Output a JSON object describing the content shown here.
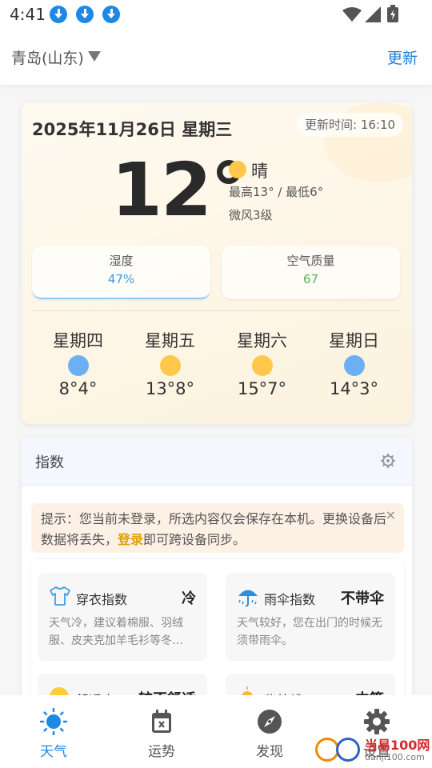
{
  "status_bar": {
    "time": "4:41"
  },
  "header": {
    "city": "青岛(山东)",
    "refresh_label": "更新"
  },
  "weather": {
    "date": "2025年11月26日 星期三",
    "update_time": "更新时间: 16:10",
    "temperature": "12°",
    "condition": "晴",
    "high_low": "最高13° / 最低6°",
    "wind": "微风3级",
    "humidity_label": "湿度",
    "humidity_value": "47%",
    "air_label": "空气质量",
    "air_value": "67",
    "colors": {
      "sun": "#ffc84a",
      "rain": "#6ab0f2",
      "humidity": "#3a9be0",
      "air": "#5bb05b"
    },
    "forecast": [
      {
        "day": "星期四",
        "icon": "rain-icon",
        "temp": "8°4°"
      },
      {
        "day": "星期五",
        "icon": "sun-icon",
        "temp": "13°8°"
      },
      {
        "day": "星期六",
        "icon": "sun-icon",
        "temp": "15°7°"
      },
      {
        "day": "星期日",
        "icon": "rain-icon",
        "temp": "14°3°"
      }
    ]
  },
  "index": {
    "title": "指数",
    "notice_prefix": "提示：您当前未登录，所选内容仅会保存在本机。更换设备后数据将丢失，",
    "notice_login": "登录",
    "notice_suffix": "即可跨设备同步。",
    "close_label": "×",
    "items": [
      {
        "name": "穿衣指数",
        "level": "冷",
        "icon": "shirt-icon",
        "desc": "天气冷，建议着棉服、羽绒服、皮夹克加羊毛衫等冬…"
      },
      {
        "name": "雨伞指数",
        "level": "不带伞",
        "icon": "umbrella-icon",
        "desc": "天气较好，您在出门的时候无须带雨伞。"
      },
      {
        "name": "舒适度",
        "level": "较不舒适",
        "icon": "face-icon",
        "desc": ""
      },
      {
        "name": "紫外线",
        "level": "中等",
        "icon": "sun-icon",
        "desc": ""
      }
    ]
  },
  "nav": {
    "items": [
      {
        "label": "天气",
        "icon": "sun-icon",
        "active": true
      },
      {
        "label": "运势",
        "icon": "calendar-icon",
        "active": false
      },
      {
        "label": "发现",
        "icon": "compass-icon",
        "active": false
      },
      {
        "label": "设置",
        "icon": "gear-icon",
        "active": false
      }
    ]
  },
  "watermark": {
    "main": "当易100网",
    "sub": "danji100.com"
  }
}
